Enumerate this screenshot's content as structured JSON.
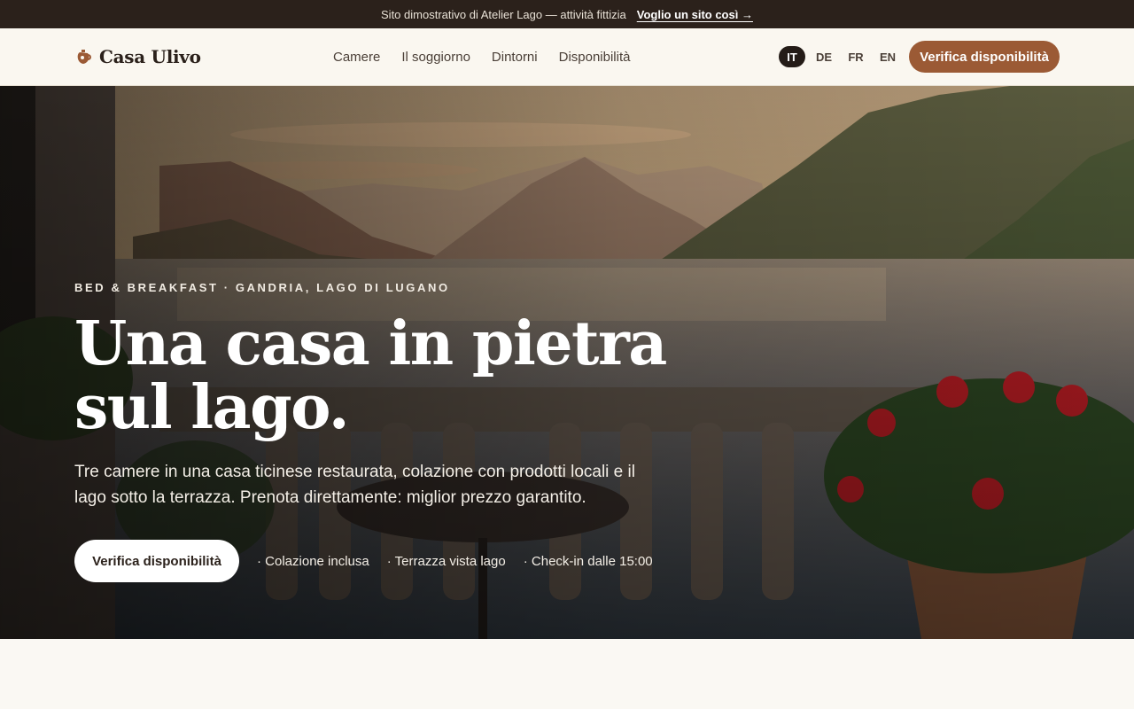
{
  "banner": {
    "text": "Sito dimostrativo di Atelier Lago — attività fittizia",
    "link": "Voglio un sito così →"
  },
  "header": {
    "logo_icon": "ceramic-jug-icon",
    "logo_text": "Casa Ulivo",
    "nav": [
      "Camere",
      "Il soggiorno",
      "Dintorni",
      "Disponibilità"
    ],
    "languages": [
      "IT",
      "DE",
      "FR",
      "EN"
    ],
    "active_language": "IT",
    "cta": "Verifica disponibilità"
  },
  "hero": {
    "eyebrow": "BED & BREAKFAST · GANDRIA, LAGO DI LUGANO",
    "title": "Una casa in pietra sul lago.",
    "subtitle": "Tre camere in una casa ticinese restaurata, colazione con prodotti locali e il lago sotto la terrazza. Prenota direttamente: miglior prezzo garantito.",
    "cta": "Verifica disponibilità",
    "features": [
      "Colazione inclusa",
      "Terrazza vista lago",
      "Check-in dalle 15:00"
    ]
  },
  "colors": {
    "accent": "#9b5a35",
    "banner_bg": "#2b211b",
    "page_bg": "#faf7f2"
  }
}
